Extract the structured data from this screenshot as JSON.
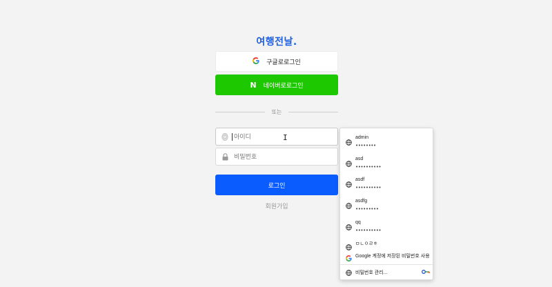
{
  "brand": "여행전날.",
  "sso": {
    "google_label": "구글로로그인",
    "naver_label": "네이버로로그인",
    "naver_letter": "N"
  },
  "divider_text": "또는",
  "form": {
    "id_placeholder": "아이디",
    "pw_placeholder": "비밀번호",
    "login_label": "로그인",
    "signup_label": "회원가입"
  },
  "autofill": {
    "credentials": [
      {
        "user": "admin",
        "dots": "••••••••"
      },
      {
        "user": "asd",
        "dots": "••••••••••"
      },
      {
        "user": "asdf",
        "dots": "••••••••••"
      },
      {
        "user": "asdfg",
        "dots": "•••••••••"
      },
      {
        "user": "qq",
        "dots": "••••••••••"
      },
      {
        "user": "ㅁㄴㅇㄹㅎ",
        "dots": ""
      }
    ],
    "google_message": "Google 계정에 저장된 비밀번호 사용",
    "manage_label": "비밀번호 관리..."
  },
  "colors": {
    "brand": "#1e5fe0",
    "naver": "#1ec800",
    "primary": "#0a5cff"
  }
}
